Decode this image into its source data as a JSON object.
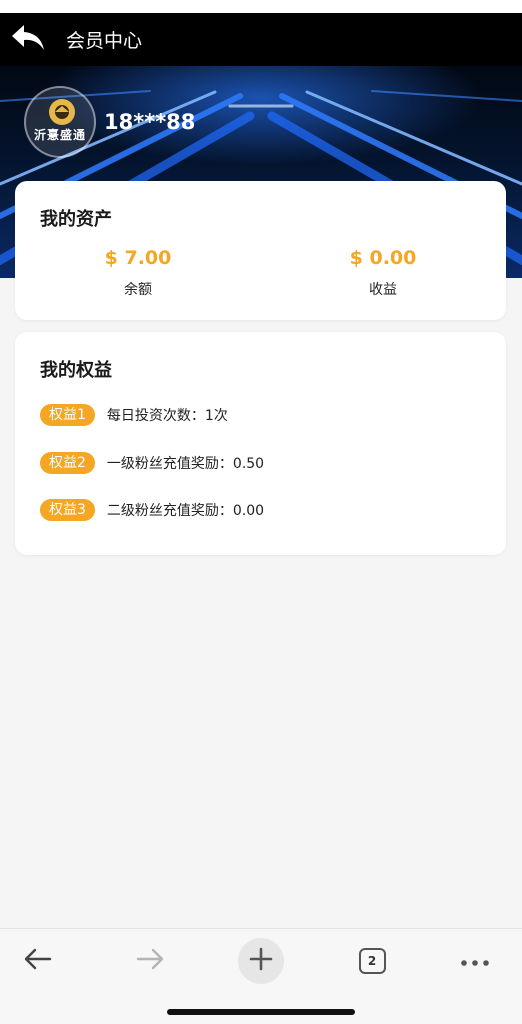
{
  "header": {
    "title": "会员中心"
  },
  "profile": {
    "avatar_text": "沂憙盛通",
    "username": "18***88"
  },
  "assets": {
    "title": "我的资产",
    "balance": {
      "value": "$ 7.00",
      "label": "余额"
    },
    "earnings": {
      "value": "$ 0.00",
      "label": "收益"
    }
  },
  "benefits": {
    "title": "我的权益",
    "items": [
      {
        "badge": "权益1",
        "text": "每日投资次数：1次"
      },
      {
        "badge": "权益2",
        "text": "一级粉丝充值奖励：0.50"
      },
      {
        "badge": "权益3",
        "text": "二级粉丝充值奖励：0.00"
      }
    ]
  },
  "browser_toolbar": {
    "tab_count": "2"
  },
  "colors": {
    "accent": "#f5a623",
    "header_bg": "#000000",
    "page_bg": "#f5f5f5"
  },
  "icons": [
    "back-arrow-icon",
    "browser-back-icon",
    "browser-forward-icon",
    "new-tab-icon",
    "tabs-icon",
    "more-icon"
  ]
}
